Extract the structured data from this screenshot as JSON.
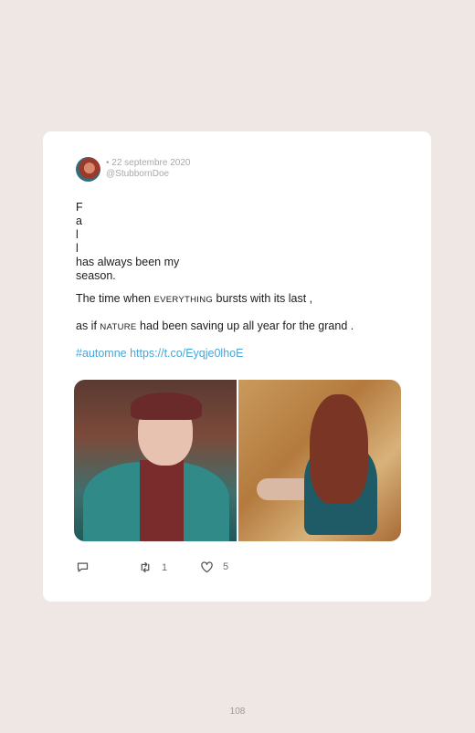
{
  "tweet": {
    "date": "• 22 septembre 2020",
    "handle": "@StubbornDoe",
    "lines": [
      "F",
      "a",
      "l",
      "l",
      "has always been my",
      "season."
    ],
    "p2_before": "The time when ",
    "p2_caps": "EVERYTHING",
    "p2_after": " bursts with its last ,",
    "p3_before": "as if ",
    "p3_caps": "NATURE",
    "p3_after": " had been saving up all year for the grand .",
    "hashtag_link": "#automne https://t.co/Eyqje0lhoE",
    "retweets": "1",
    "likes": "5"
  },
  "page_number": "108",
  "colors": {
    "background": "#efe7e4",
    "card": "#ffffff",
    "link": "#4aa6d8",
    "meta": "#a8a8a8"
  },
  "icons": [
    "reply-icon",
    "retweet-icon",
    "like-icon"
  ]
}
